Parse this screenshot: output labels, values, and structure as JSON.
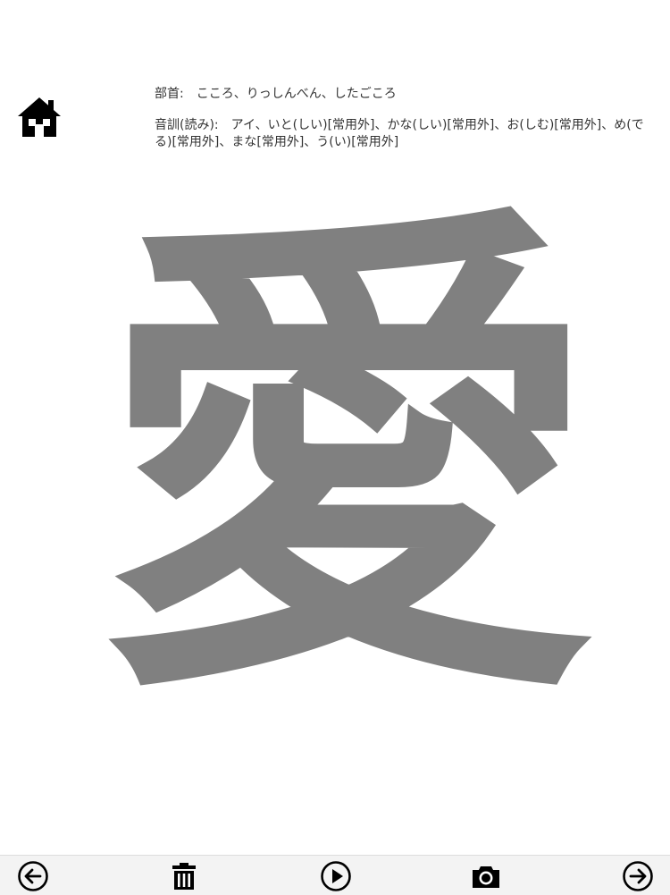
{
  "header": {
    "home_icon": "home-icon"
  },
  "info": {
    "radical_label": "部首:",
    "radical_value": "こころ、りっしんべん、したごころ",
    "reading_label": "音訓(読み):",
    "reading_value": "アイ、いと(しい)[常用外]、かな(しい)[常用外]、お(しむ)[常用外]、め(でる)[常用外]、まな[常用外]、う(い)[常用外]"
  },
  "kanji": {
    "character": "愛",
    "color": "#808080"
  },
  "toolbar": {
    "back_icon": "arrow-left-circle-icon",
    "delete_icon": "trash-icon",
    "play_icon": "play-circle-icon",
    "camera_icon": "camera-icon",
    "forward_icon": "arrow-right-circle-icon"
  }
}
